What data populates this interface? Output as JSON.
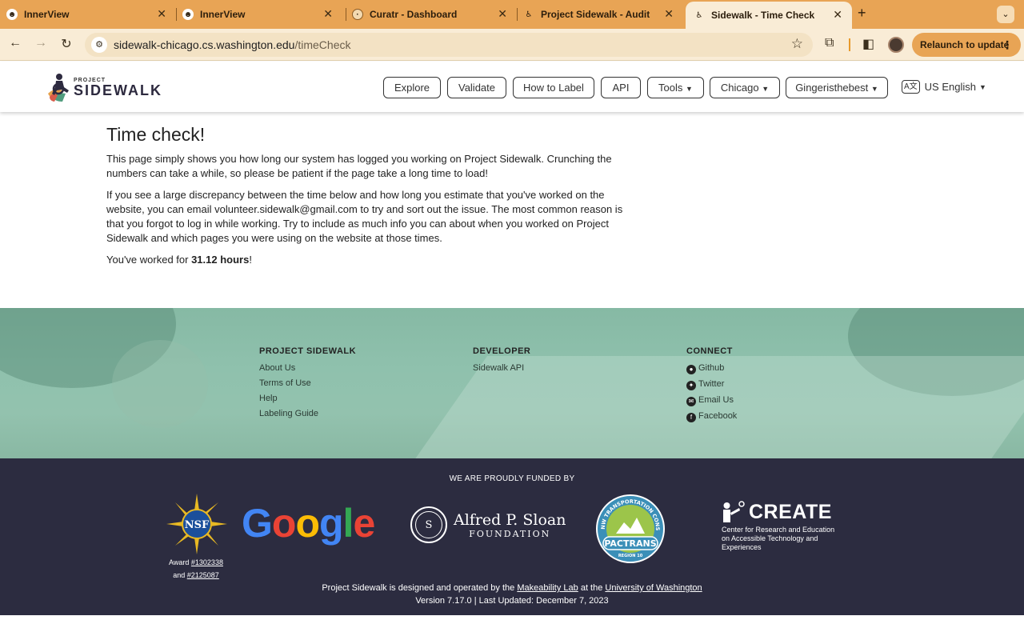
{
  "browser": {
    "tabs": [
      {
        "title": "InnerView",
        "active": false
      },
      {
        "title": "InnerView",
        "active": false
      },
      {
        "title": "Curatr - Dashboard",
        "active": false
      },
      {
        "title": "Project Sidewalk - Audit",
        "active": false
      },
      {
        "title": "Sidewalk - Time Check",
        "active": true
      }
    ],
    "url_host": "sidewalk-chicago.cs.washington.edu",
    "url_path": "/timeCheck",
    "relaunch_label": "Relaunch to update",
    "colors": {
      "tabbar": "#e8a455",
      "toolbar": "#f9ecd6"
    }
  },
  "header": {
    "logo_small": "PROJECT",
    "logo_big": "SIDEWALK",
    "nav": [
      {
        "label": "Explore",
        "dropdown": false
      },
      {
        "label": "Validate",
        "dropdown": false
      },
      {
        "label": "How to Label",
        "dropdown": false
      },
      {
        "label": "API",
        "dropdown": false
      },
      {
        "label": "Tools",
        "dropdown": true
      },
      {
        "label": "Chicago",
        "dropdown": true
      },
      {
        "label": "Gingeristhebest",
        "dropdown": true
      }
    ],
    "language": "US English"
  },
  "main": {
    "title": "Time check!",
    "para1": "This page simply shows you how long our system has logged you working on Project Sidewalk. Crunching the numbers can take a while, so please be patient if the page take a long time to load!",
    "para2": "If you see a large discrepancy between the time below and how long you estimate that you've worked on the website, you can email volunteer.sidewalk@gmail.com to try and sort out the issue. The most common reason is that you forgot to log in while working. Try to include as much info you can about when you worked on Project Sidewalk and which pages you were using on the website at those times.",
    "worked_prefix": "You've worked for ",
    "worked_value": "31.12 hours",
    "worked_suffix": "!"
  },
  "footer": {
    "columns": [
      {
        "heading": "PROJECT SIDEWALK",
        "links": [
          "About Us",
          "Terms of Use",
          "Help",
          "Labeling Guide"
        ]
      },
      {
        "heading": "DEVELOPER",
        "links": [
          "Sidewalk API"
        ]
      },
      {
        "heading": "CONNECT",
        "links": [
          "Github",
          "Twitter",
          "Email Us",
          "Facebook"
        ]
      }
    ],
    "connect_icons": [
      "github-icon",
      "twitter-icon",
      "email-icon",
      "facebook-icon"
    ]
  },
  "funders": {
    "heading": "WE ARE PROUDLY FUNDED BY",
    "nsf_award_prefix": "Award ",
    "nsf_award_1": "#1302338",
    "nsf_award_and": "and ",
    "nsf_award_2": "#2125087",
    "nsf_text": "NSF",
    "google": [
      "G",
      "o",
      "o",
      "g",
      "l",
      "e"
    ],
    "google_colors": [
      "#4285F4",
      "#EA4335",
      "#FBBC05",
      "#4285F4",
      "#34A853",
      "#EA4335"
    ],
    "sloan_line1": "Alfred P. Sloan",
    "sloan_line2": "FOUNDATION",
    "pactrans_name": "PACTRANS",
    "pactrans_ring": "PACIFIC NW TRANSPORTATION CONSORTIUM",
    "pactrans_region": "REGION 10",
    "create_title": "CREATE",
    "create_sub": "Center for Research and Education on Accessible Technology and Experiences",
    "credit_prefix": "Project Sidewalk is designed and operated by the ",
    "credit_lab": "Makeability Lab",
    "credit_mid": " at the ",
    "credit_uw": "University of Washington",
    "version": "Version 7.17.0 | Last Updated: December 7, 2023"
  }
}
